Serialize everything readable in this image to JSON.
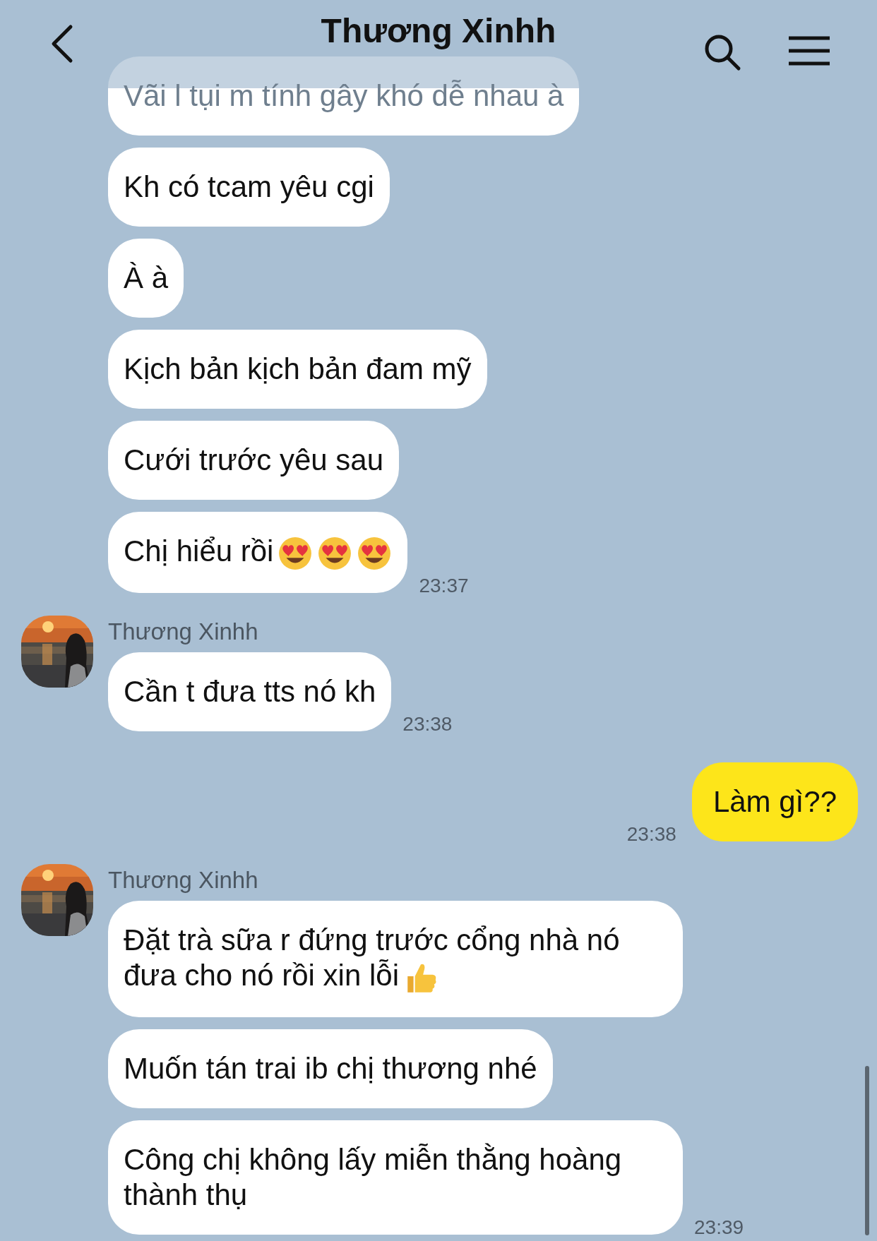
{
  "header": {
    "title": "Thương Xinhh"
  },
  "groups": [
    {
      "kind": "them",
      "time": "23:37",
      "bubbles": [
        {
          "text": "Vãi l tụi m tính gây khó dễ nhau à"
        },
        {
          "text": "Kh có tcam yêu cgi"
        },
        {
          "text": "À à"
        },
        {
          "text": "Kịch bản kịch bản đam mỹ"
        },
        {
          "text": "Cưới trước yêu sau"
        },
        {
          "text": "Chị hiểu rồi",
          "emojis": [
            {
              "kind": "heart_eyes"
            },
            {
              "kind": "heart_eyes"
            },
            {
              "kind": "heart_eyes"
            }
          ]
        }
      ]
    },
    {
      "kind": "them",
      "sender": "Thương Xinhh",
      "time": "23:38",
      "bubbles": [
        {
          "text": "Cần t đưa tts nó kh"
        }
      ]
    },
    {
      "kind": "me",
      "time": "23:38",
      "bubbles": [
        {
          "text": "Làm gì??"
        }
      ]
    },
    {
      "kind": "them",
      "sender": "Thương Xinhh",
      "time": "23:39",
      "bubbles": [
        {
          "text": "Đặt trà sữa r đứng trước cổng nhà nó đưa cho nó rồi xin lỗi",
          "emojis": [
            {
              "kind": "thumbs_up"
            }
          ]
        },
        {
          "text": "Muốn tán trai ib chị thương nhé"
        },
        {
          "text": "Công chị không lấy miễn thằng hoàng thành thụ"
        }
      ]
    }
  ]
}
